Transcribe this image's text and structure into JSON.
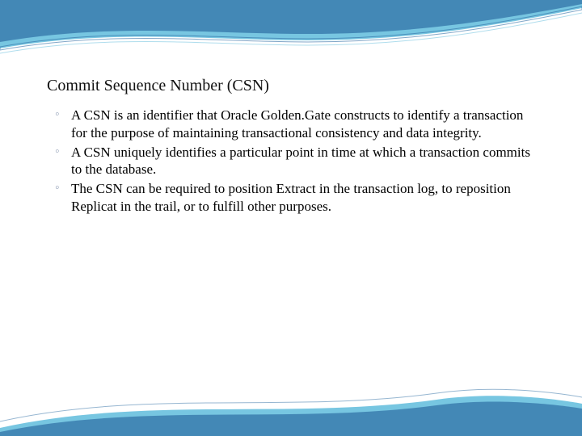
{
  "title": "Commit Sequence Number (CSN)",
  "bullets": [
    "A CSN is an identifier that Oracle Golden.Gate constructs to identify a transaction for the purpose of maintaining transactional consistency and data integrity.",
    "A CSN uniquely identifies a particular point in time at which a transaction commits to the database.",
    "The CSN can be required to position Extract in the transaction log, to reposition Replicat in the trail, or to fulfill other purposes."
  ]
}
